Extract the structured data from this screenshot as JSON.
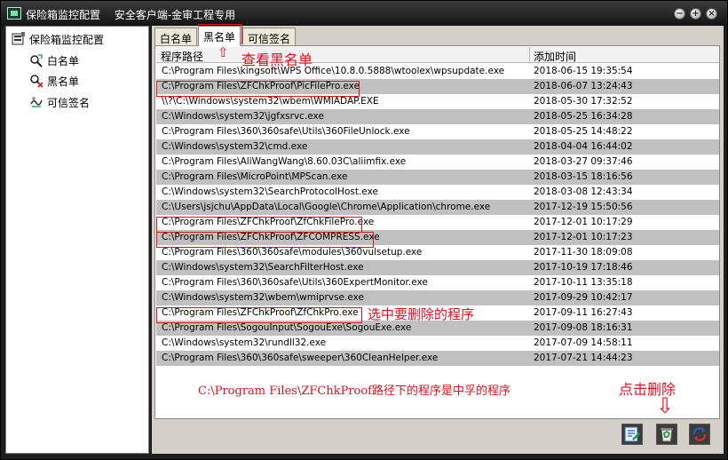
{
  "window": {
    "title": "保险箱监控配置",
    "subtitle": "安全客户端-金审工程专用"
  },
  "tree": {
    "root_label": "保险箱监控配置",
    "items": [
      {
        "label": "白名单",
        "icon": "whitelist-icon"
      },
      {
        "label": "黑名单",
        "icon": "blacklist-icon"
      },
      {
        "label": "可信签名",
        "icon": "trusted-signature-icon"
      }
    ]
  },
  "tabs": [
    {
      "label": "白名单",
      "active": false
    },
    {
      "label": "黑名单",
      "active": true
    },
    {
      "label": "可信签名",
      "active": false
    }
  ],
  "table": {
    "columns": [
      "程序路径",
      "添加时间"
    ],
    "rows": [
      {
        "path": "C:\\Program Files\\kingsoft\\WPS Office\\10.8.0.5888\\wtoolex\\wpsupdate.exe",
        "time": "2018-06-15 19:35:54",
        "shaded": false
      },
      {
        "path": "C:\\Program Files\\ZFChkProof\\PicFilePro.exe",
        "time": "2018-06-07 13:24:43",
        "shaded": true
      },
      {
        "path": "\\\\?\\C:\\Windows\\system32\\wbem\\WMIADAP.EXE",
        "time": "2018-05-30 17:32:52",
        "shaded": false
      },
      {
        "path": "C:\\Windows\\system32\\jgfxsrvc.exe",
        "time": "2018-05-25 16:34:28",
        "shaded": true
      },
      {
        "path": "C:\\Program Files\\360\\360safe\\Utils\\360FileUnlock.exe",
        "time": "2018-05-25 14:48:22",
        "shaded": false
      },
      {
        "path": "C:\\Windows\\system32\\cmd.exe",
        "time": "2018-04-04 16:44:02",
        "shaded": true
      },
      {
        "path": "C:\\Program Files\\AliWangWang\\8.60.03C\\aliimfix.exe",
        "time": "2018-03-27 09:37:46",
        "shaded": false
      },
      {
        "path": "C:\\Program Files\\MicroPoint\\MPScan.exe",
        "time": "2018-03-15 18:16:56",
        "shaded": true
      },
      {
        "path": "C:\\Windows\\system32\\SearchProtocolHost.exe",
        "time": "2018-03-08 12:43:34",
        "shaded": false
      },
      {
        "path": "C:\\Users\\jsjchu\\AppData\\Local\\Google\\Chrome\\Application\\chrome.exe",
        "time": "2017-12-19 15:50:56",
        "shaded": true
      },
      {
        "path": "C:\\Program Files\\ZFChkProof\\ZfChkFilePro.exe",
        "time": "2017-12-01 10:17:29",
        "shaded": false
      },
      {
        "path": "C:\\Program Files\\ZFChkProof\\ZFCOMPRESS.exe",
        "time": "2017-12-01 10:17:23",
        "shaded": true
      },
      {
        "path": "C:\\Program Files\\360\\360safe\\modules\\360vulsetup.exe",
        "time": "2017-11-30 18:09:08",
        "shaded": false
      },
      {
        "path": "C:\\Windows\\system32\\SearchFilterHost.exe",
        "time": "2017-10-19 17:18:46",
        "shaded": true
      },
      {
        "path": "C:\\Program Files\\360\\360safe\\Utils\\360ExpertMonitor.exe",
        "time": "2017-10-11 13:35:18",
        "shaded": false
      },
      {
        "path": "C:\\Windows\\system32\\wbem\\wmiprvse.exe",
        "time": "2017-09-29 10:42:17",
        "shaded": true
      },
      {
        "path": "C:\\Program Files\\ZFChkProof\\ZfChkPro.exe",
        "time": "2017-09-11 16:27:43",
        "shaded": false
      },
      {
        "path": "C:\\Program Files\\SogouInput\\SogouExe\\SogouExe.exe",
        "time": "2017-09-08 18:16:31",
        "shaded": true
      },
      {
        "path": "C:\\Windows\\system32\\rundll32.exe",
        "time": "2017-07-09 14:58:11",
        "shaded": false
      },
      {
        "path": "C:\\Program Files\\360\\360safe\\sweeper\\360CleanHelper.exe",
        "time": "2017-07-21 14:44:23",
        "shaded": true
      }
    ]
  },
  "annotations": {
    "view_blacklist": "查看黑名单",
    "select_program": "选中要删除的程序",
    "note": "C:\\Program Files\\ZFChkProof路径下的程序是中孚的程序",
    "click_delete": "点击删除",
    "arrow_up": "⇧",
    "arrow_down": "⇩",
    "color": "#e01020"
  },
  "toolbar": {
    "buttons": [
      "edit-icon",
      "recycle-delete-icon",
      "refresh-icon"
    ]
  }
}
